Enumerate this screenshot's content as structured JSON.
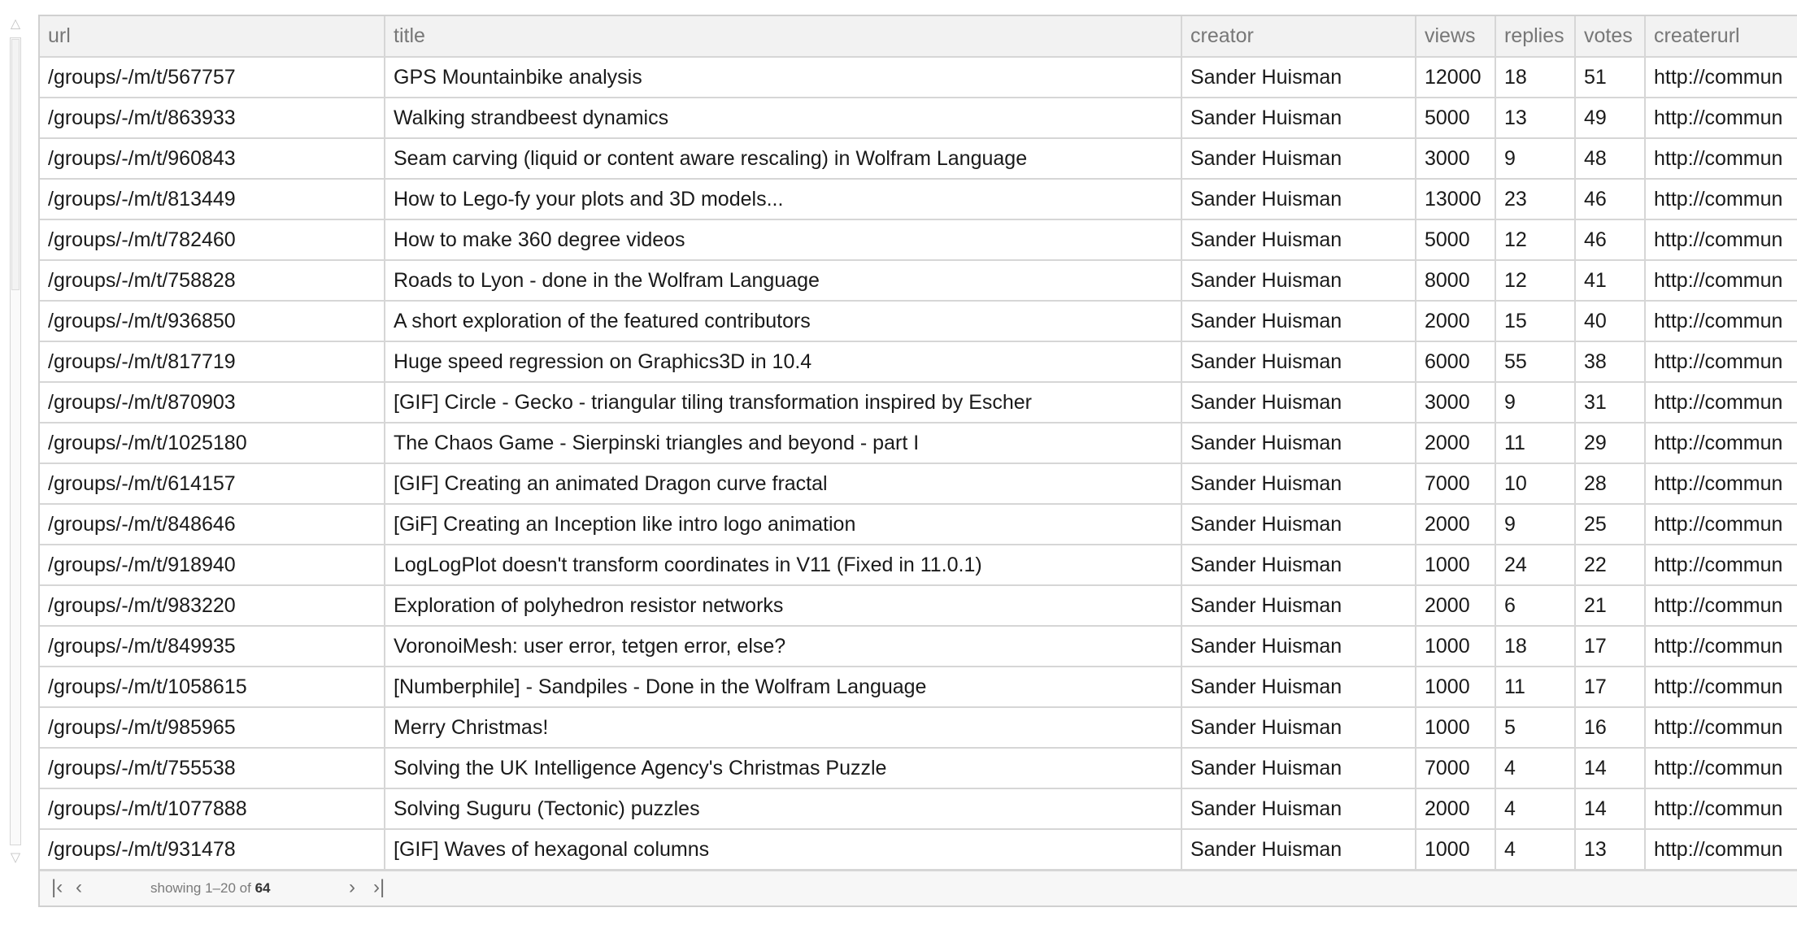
{
  "table": {
    "columns": [
      "url",
      "title",
      "creator",
      "views",
      "replies",
      "votes",
      "createrurl"
    ],
    "rows": [
      [
        "/groups/-/m/t/567757",
        "GPS Mountainbike analysis",
        "Sander Huisman",
        "12000",
        "18",
        "51",
        "http://commun"
      ],
      [
        "/groups/-/m/t/863933",
        "Walking strandbeest dynamics",
        "Sander Huisman",
        "5000",
        "13",
        "49",
        "http://commun"
      ],
      [
        "/groups/-/m/t/960843",
        "Seam carving (liquid or content aware rescaling) in Wolfram Language",
        "Sander Huisman",
        "3000",
        "9",
        "48",
        "http://commun"
      ],
      [
        "/groups/-/m/t/813449",
        "How to Lego-fy your plots and 3D models...",
        "Sander Huisman",
        "13000",
        "23",
        "46",
        "http://commun"
      ],
      [
        "/groups/-/m/t/782460",
        "How to make 360 degree videos",
        "Sander Huisman",
        "5000",
        "12",
        "46",
        "http://commun"
      ],
      [
        "/groups/-/m/t/758828",
        "Roads to Lyon - done in the Wolfram Language",
        "Sander Huisman",
        "8000",
        "12",
        "41",
        "http://commun"
      ],
      [
        "/groups/-/m/t/936850",
        "A short exploration of the featured contributors",
        "Sander Huisman",
        "2000",
        "15",
        "40",
        "http://commun"
      ],
      [
        "/groups/-/m/t/817719",
        "Huge speed regression on Graphics3D in 10.4",
        "Sander Huisman",
        "6000",
        "55",
        "38",
        "http://commun"
      ],
      [
        "/groups/-/m/t/870903",
        "[GIF] Circle - Gecko - triangular tiling transformation inspired by Escher",
        "Sander Huisman",
        "3000",
        "9",
        "31",
        "http://commun"
      ],
      [
        "/groups/-/m/t/1025180",
        "The Chaos Game - Sierpinski triangles and beyond - part I",
        "Sander Huisman",
        "2000",
        "11",
        "29",
        "http://commun"
      ],
      [
        "/groups/-/m/t/614157",
        "[GIF] Creating an animated Dragon curve fractal",
        "Sander Huisman",
        "7000",
        "10",
        "28",
        "http://commun"
      ],
      [
        "/groups/-/m/t/848646",
        "[GiF] Creating an Inception like intro logo animation",
        "Sander Huisman",
        "2000",
        "9",
        "25",
        "http://commun"
      ],
      [
        "/groups/-/m/t/918940",
        "LogLogPlot doesn't transform coordinates in V11 (Fixed in 11.0.1)",
        "Sander Huisman",
        "1000",
        "24",
        "22",
        "http://commun"
      ],
      [
        "/groups/-/m/t/983220",
        "Exploration of polyhedron resistor networks",
        "Sander Huisman",
        "2000",
        "6",
        "21",
        "http://commun"
      ],
      [
        "/groups/-/m/t/849935",
        "VoronoiMesh: user error, tetgen error, else?",
        "Sander Huisman",
        "1000",
        "18",
        "17",
        "http://commun"
      ],
      [
        "/groups/-/m/t/1058615",
        "[Numberphile] - Sandpiles - Done in the Wolfram Language",
        "Sander Huisman",
        "1000",
        "11",
        "17",
        "http://commun"
      ],
      [
        "/groups/-/m/t/985965",
        "Merry Christmas!",
        "Sander Huisman",
        "1000",
        "5",
        "16",
        "http://commun"
      ],
      [
        "/groups/-/m/t/755538",
        "Solving the UK Intelligence Agency's Christmas Puzzle",
        "Sander Huisman",
        "7000",
        "4",
        "14",
        "http://commun"
      ],
      [
        "/groups/-/m/t/1077888",
        "Solving Suguru (Tectonic) puzzles",
        "Sander Huisman",
        "2000",
        "4",
        "14",
        "http://commun"
      ],
      [
        "/groups/-/m/t/931478",
        "[GIF] Waves of hexagonal columns",
        "Sander Huisman",
        "1000",
        "4",
        "13",
        "http://commun"
      ]
    ]
  },
  "pagination": {
    "first_icon": "first-page-icon",
    "prev_icon": "previous-page-icon",
    "next_icon": "next-page-icon",
    "last_icon": "last-page-icon",
    "showing_prefix": "showing 1–20 of",
    "total": "64"
  },
  "scrollbar": {
    "position_fraction": 0.0,
    "visible_fraction": 0.3125
  },
  "colors": {
    "header_bg": "#f2f2f2",
    "grid_line": "#d6d6d6",
    "header_text": "#777777",
    "cell_text": "#1a1a1a"
  }
}
